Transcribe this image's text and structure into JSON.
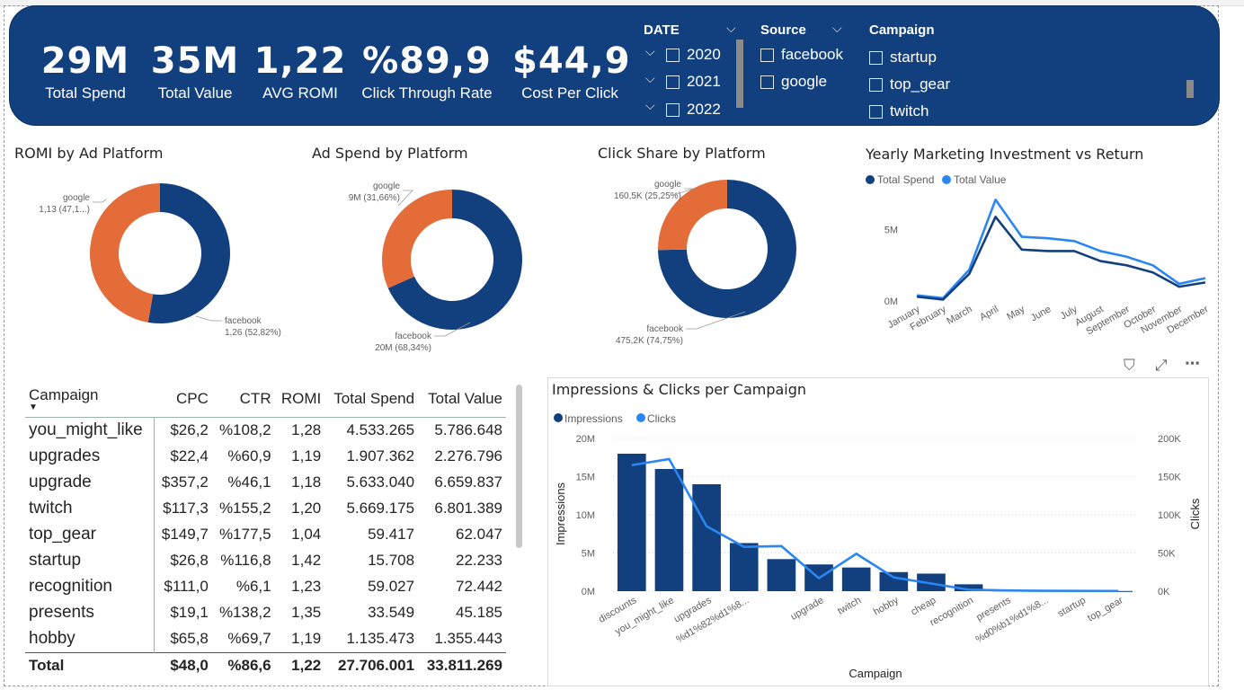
{
  "kpis": [
    {
      "value": "29M",
      "label": "Total Spend"
    },
    {
      "value": "35M",
      "label": "Total Value"
    },
    {
      "value": "1,22",
      "label": "AVG ROMI"
    },
    {
      "value": "%89,9",
      "label": "Click Through Rate"
    },
    {
      "value": "$44,9",
      "label": "Cost Per Click"
    }
  ],
  "slicers": {
    "date": {
      "title": "DATE",
      "items": [
        "2020",
        "2021",
        "2022"
      ]
    },
    "source": {
      "title": "Source",
      "items": [
        "facebook",
        "google"
      ]
    },
    "campaign": {
      "title": "Campaign",
      "items": [
        "startup",
        "top_gear",
        "twitch"
      ]
    }
  },
  "visuals": {
    "romi": {
      "title": "ROMI by Ad Platform"
    },
    "spend": {
      "title": "Ad Spend by Platform"
    },
    "clicks": {
      "title": "Click Share by Platform"
    },
    "yearly": {
      "title": "Yearly Marketing Investment vs Return"
    },
    "impressions": {
      "title": "Impressions & Clicks per Campaign"
    }
  },
  "colors": {
    "facebook": "#12407f",
    "google": "#e36c39",
    "total_spend": "#12407f",
    "total_value": "#2b86f2",
    "banner": "#12407f"
  },
  "table": {
    "columns": [
      "Campaign",
      "CPC",
      "CTR",
      "ROMI",
      "Total Spend",
      "Total Value"
    ],
    "rows": [
      [
        "you_might_like",
        "$26,2",
        "%108,2",
        "1,28",
        "4.533.265",
        "5.786.648"
      ],
      [
        "upgrades",
        "$22,4",
        "%60,9",
        "1,19",
        "1.907.362",
        "2.276.796"
      ],
      [
        "upgrade",
        "$357,2",
        "%46,1",
        "1,18",
        "5.633.040",
        "6.659.837"
      ],
      [
        "twitch",
        "$117,3",
        "%155,2",
        "1,20",
        "5.669.175",
        "6.801.389"
      ],
      [
        "top_gear",
        "$149,7",
        "%177,5",
        "1,04",
        "59.417",
        "62.047"
      ],
      [
        "startup",
        "$26,8",
        "%116,8",
        "1,42",
        "15.708",
        "22.233"
      ],
      [
        "recognition",
        "$111,0",
        "%6,1",
        "1,23",
        "59.027",
        "72.442"
      ],
      [
        "presents",
        "$19,1",
        "%138,2",
        "1,35",
        "33.549",
        "45.185"
      ],
      [
        "hobby",
        "$65,8",
        "%69,7",
        "1,19",
        "1.135.473",
        "1.355.443"
      ]
    ],
    "total": [
      "Total",
      "$48,0",
      "%86,6",
      "1,22",
      "27.706.001",
      "33.811.269"
    ]
  },
  "chart_data": [
    {
      "type": "pie",
      "title": "ROMI by Ad Platform",
      "slices": [
        {
          "name": "facebook",
          "value": 1.26,
          "label": "1,26 (52,82%)"
        },
        {
          "name": "google",
          "value": 1.13,
          "label": "1,13 (47,1...)"
        }
      ]
    },
    {
      "type": "pie",
      "title": "Ad Spend by Platform",
      "slices": [
        {
          "name": "facebook",
          "value": 68.34,
          "label": "20M (68,34%)"
        },
        {
          "name": "google",
          "value": 31.66,
          "label": "9M (31,66%)"
        }
      ]
    },
    {
      "type": "pie",
      "title": "Click Share by Platform",
      "slices": [
        {
          "name": "facebook",
          "value": 74.75,
          "label": "475,2K (74,75%)"
        },
        {
          "name": "google",
          "value": 25.25,
          "label": "160,5K (25,25%)"
        }
      ]
    },
    {
      "type": "line",
      "title": "Yearly Marketing Investment vs Return",
      "categories": [
        "January",
        "February",
        "March",
        "April",
        "May",
        "June",
        "July",
        "August",
        "September",
        "October",
        "November",
        "December"
      ],
      "series": [
        {
          "name": "Total Spend",
          "values": [
            0.3,
            0.1,
            1.9,
            5.9,
            3.6,
            3.5,
            3.5,
            2.8,
            2.5,
            2.0,
            1.0,
            1.3
          ]
        },
        {
          "name": "Total Value",
          "values": [
            0.4,
            0.2,
            2.2,
            7.1,
            4.5,
            4.4,
            4.2,
            3.5,
            3.1,
            2.5,
            1.2,
            1.6
          ]
        }
      ],
      "yticks": [
        "0M",
        "5M"
      ],
      "ylim": [
        0,
        8
      ]
    },
    {
      "type": "bar",
      "title": "Impressions & Clicks per Campaign",
      "xlabel": "Campaign",
      "ylabel": "Impressions",
      "y2label": "Clicks",
      "categories": [
        "discounts",
        "you_might_like",
        "upgrades",
        "%d1%82%d1%8...",
        "",
        "upgrade",
        "twitch",
        "hobby",
        "cheap",
        "recognition",
        "presents",
        "%d0%b1%d1%8...",
        "startup",
        "top_gear"
      ],
      "series": [
        {
          "name": "Impressions",
          "values": [
            18.0,
            16.0,
            14.0,
            6.3,
            4.2,
            3.5,
            3.1,
            2.5,
            2.3,
            0.9,
            0.1,
            0.05,
            0.03,
            0.02
          ]
        },
        {
          "name": "Clicks",
          "values": [
            165,
            173,
            85,
            58,
            59,
            17,
            49,
            18,
            10,
            2,
            1,
            0.5,
            0.4,
            0.3
          ]
        }
      ],
      "ylim": [
        0,
        20
      ],
      "y2lim": [
        0,
        200
      ],
      "yticks": [
        "0M",
        "5M",
        "10M",
        "15M",
        "20M"
      ],
      "y2ticks": [
        "0K",
        "50K",
        "100K",
        "150K",
        "200K"
      ]
    }
  ]
}
